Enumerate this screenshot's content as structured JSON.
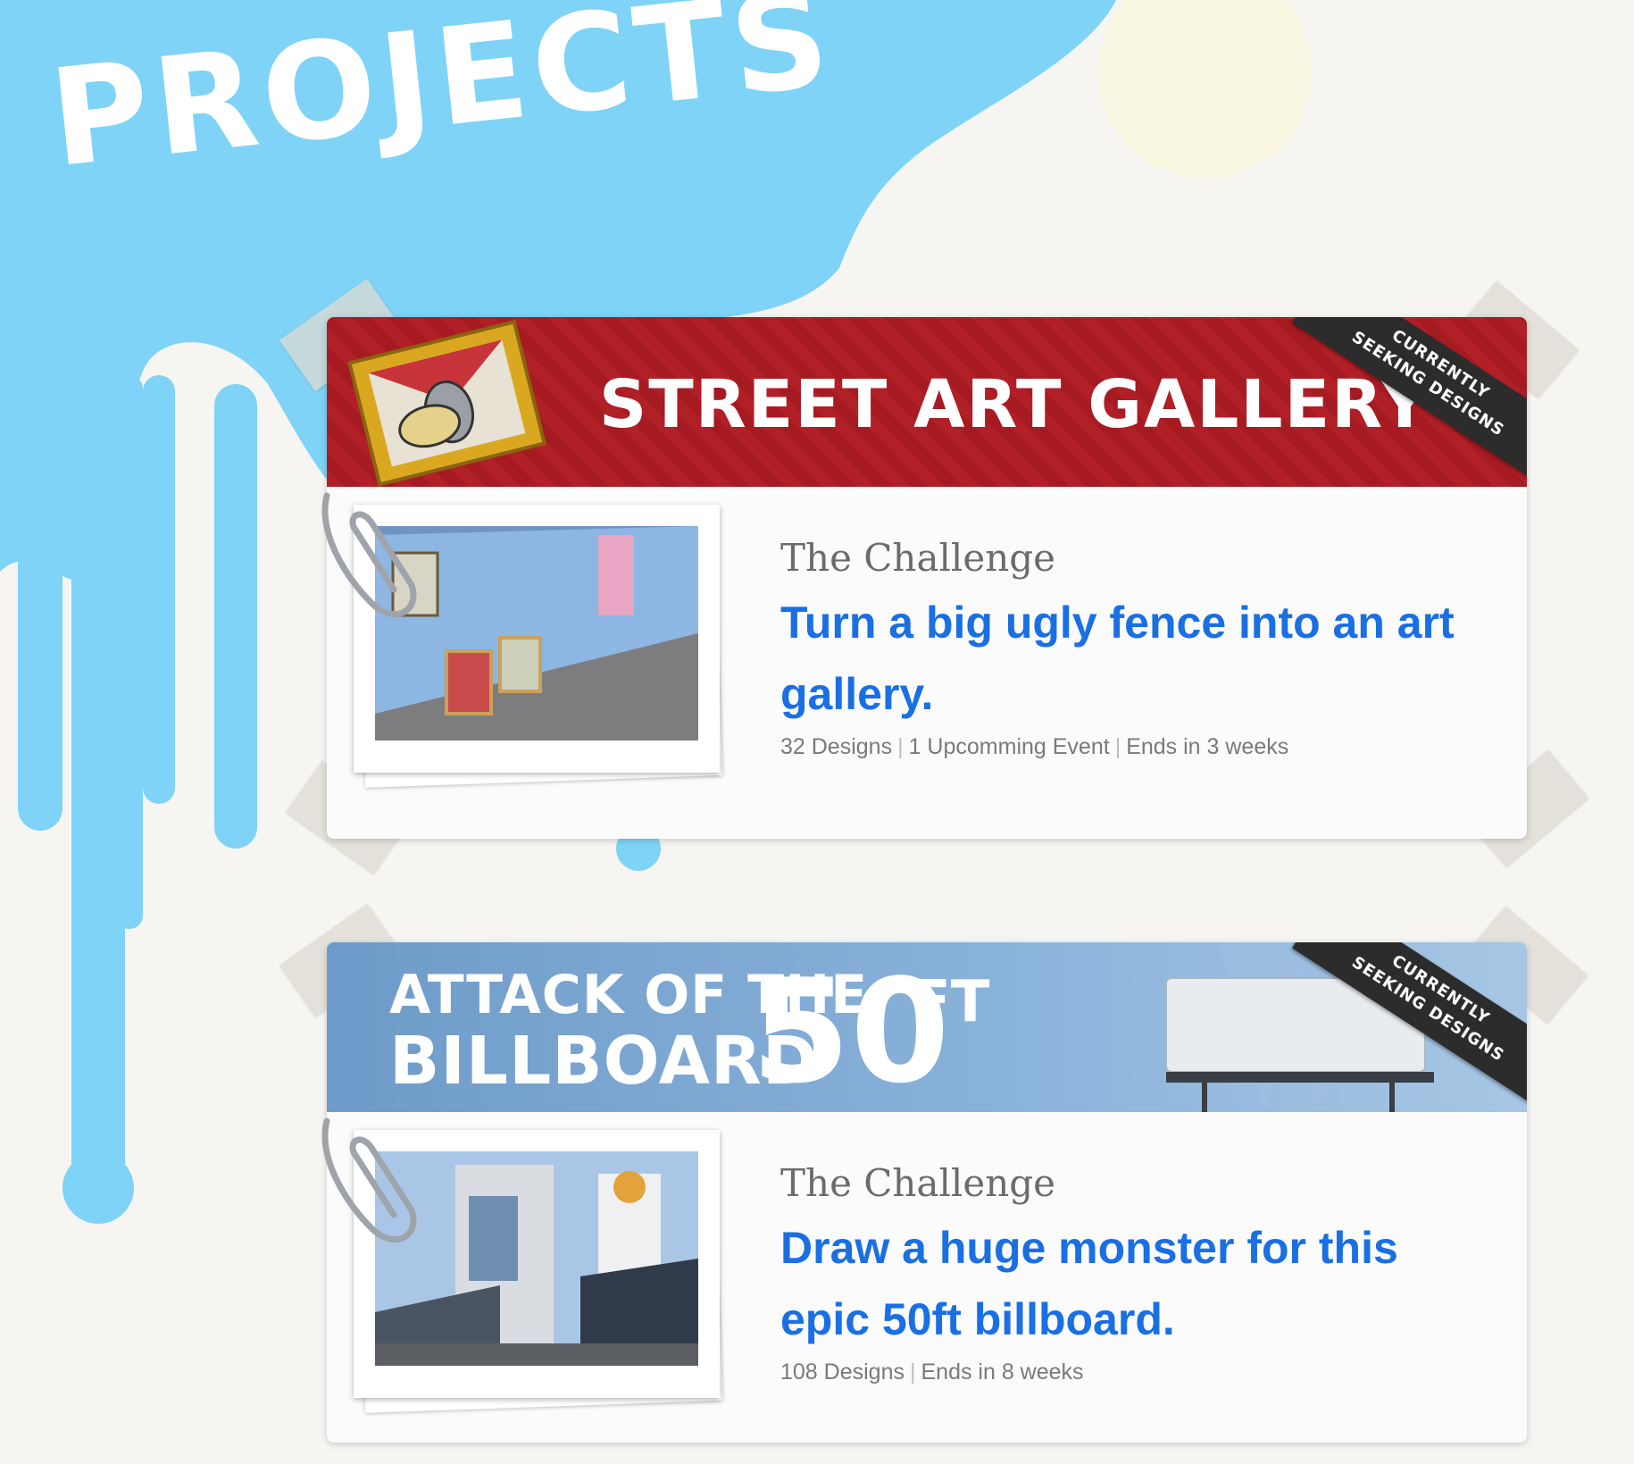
{
  "page": {
    "title": "PROJECTS"
  },
  "projects": [
    {
      "banner_title": "STREET ART GALLERY",
      "ribbon": [
        "CURRENTLY",
        "SEEKING DESIGNS"
      ],
      "challenge_heading": "The Challenge",
      "challenge_text": "Turn a big ugly fence into an art gallery.",
      "meta": {
        "designs": "32 Designs",
        "events": "1 Upcomming Event",
        "ends": "Ends in 3 weeks"
      }
    },
    {
      "banner_title_line1": "ATTACK OF THE",
      "banner_title_line2": "BILLBOARD",
      "banner_title_big": "50",
      "banner_title_unit": "FT",
      "ribbon": [
        "CURRENTLY",
        "SEEKING DESIGNS"
      ],
      "challenge_heading": "The Challenge",
      "challenge_text": "Draw a huge monster for this epic 50ft billboard.",
      "meta": {
        "designs": "108 Designs",
        "ends": "Ends in 8 weeks"
      }
    }
  ],
  "colors": {
    "splash": "#7fd3f7",
    "link": "#1a6fe3",
    "banner_red": "#b11f27",
    "banner_blue": "#7ba6d3",
    "ribbon": "#2c2c2c"
  },
  "icons": {
    "clip": "paperclip-icon",
    "frame": "picture-frame-icon",
    "spray": "spray-can-icon",
    "billboard": "billboard-icon"
  }
}
